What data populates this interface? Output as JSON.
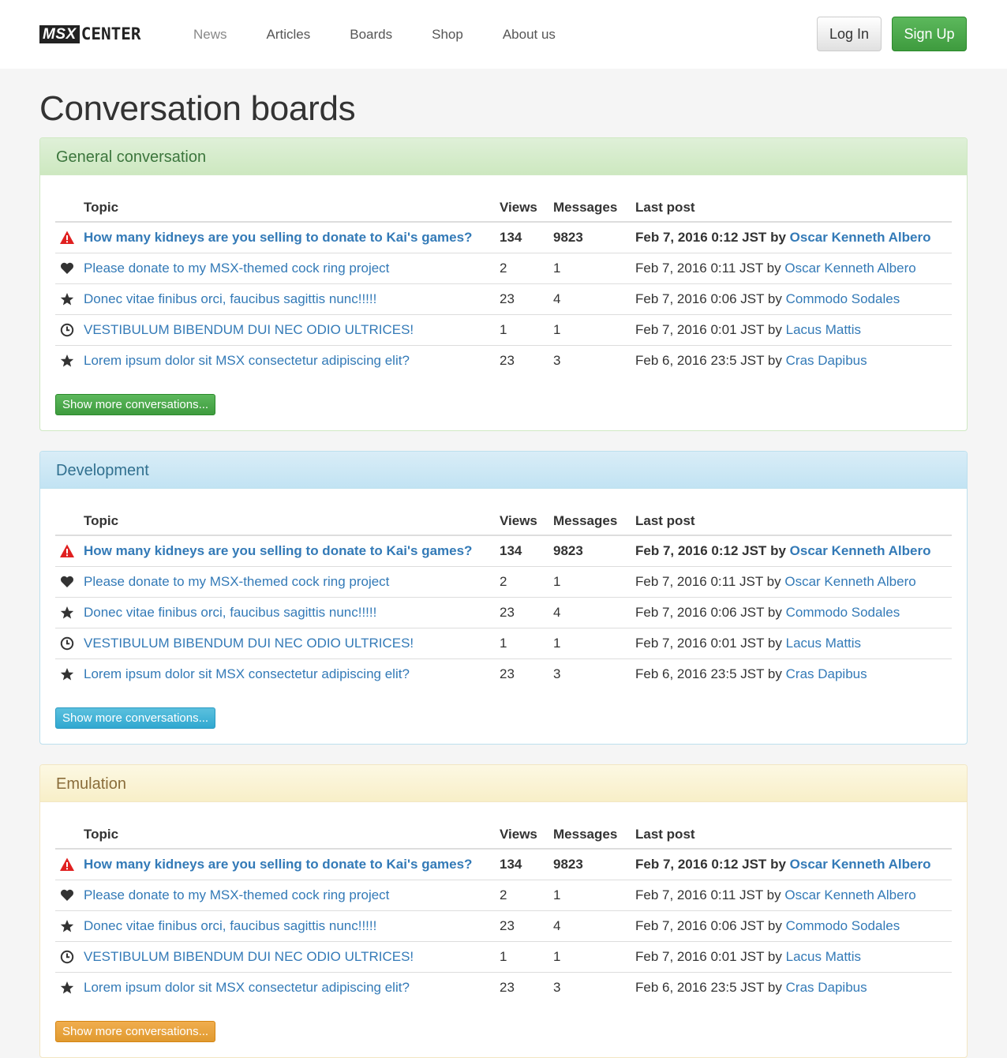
{
  "navbar": {
    "logo_box": "MSX",
    "logo_text": "CENTER",
    "links": [
      "News",
      "Articles",
      "Boards",
      "Shop",
      "About us"
    ],
    "login": "Log In",
    "signup": "Sign Up"
  },
  "page_title": "Conversation boards",
  "columns": {
    "topic": "Topic",
    "views": "Views",
    "messages": "Messages",
    "last_post": "Last post"
  },
  "show_more": "Show more conversations...",
  "by": "by",
  "rows": [
    {
      "icon": "warning-icon",
      "topic": "How many kidneys are you selling to donate to Kai's games?",
      "views": "134",
      "messages": "9823",
      "date": "Feb 7, 2016 0:12 JST",
      "author": "Oscar Kenneth Albero",
      "hot": true
    },
    {
      "icon": "heart-icon",
      "topic": "Please donate to my MSX-themed cock ring project",
      "views": "2",
      "messages": "1",
      "date": "Feb 7, 2016 0:11 JST",
      "author": "Oscar Kenneth Albero",
      "hot": false
    },
    {
      "icon": "star-icon",
      "topic": "Donec vitae finibus orci, faucibus sagittis nunc!!!!!",
      "views": "23",
      "messages": "4",
      "date": "Feb 7, 2016 0:06 JST",
      "author": "Commodo Sodales",
      "hot": false
    },
    {
      "icon": "clock-icon",
      "topic": "VESTIBULUM BIBENDUM DUI NEC ODIO ULTRICES!",
      "views": "1",
      "messages": "1",
      "date": "Feb 7, 2016 0:01 JST",
      "author": "Lacus Mattis",
      "hot": false
    },
    {
      "icon": "star-icon",
      "topic": "Lorem ipsum dolor sit MSX consectetur adipiscing elit?",
      "views": "23",
      "messages": "3",
      "date": "Feb 6, 2016 23:5 JST",
      "author": "Cras Dapibus",
      "hot": false
    }
  ],
  "boards": [
    {
      "title": "General conversation",
      "style": "success"
    },
    {
      "title": "Development",
      "style": "info"
    },
    {
      "title": "Emulation",
      "style": "warning"
    }
  ],
  "colors": {
    "link": "#337ab7",
    "warning_icon": "#e02020",
    "success": "#5cb85c",
    "info": "#5bc0de"
  }
}
